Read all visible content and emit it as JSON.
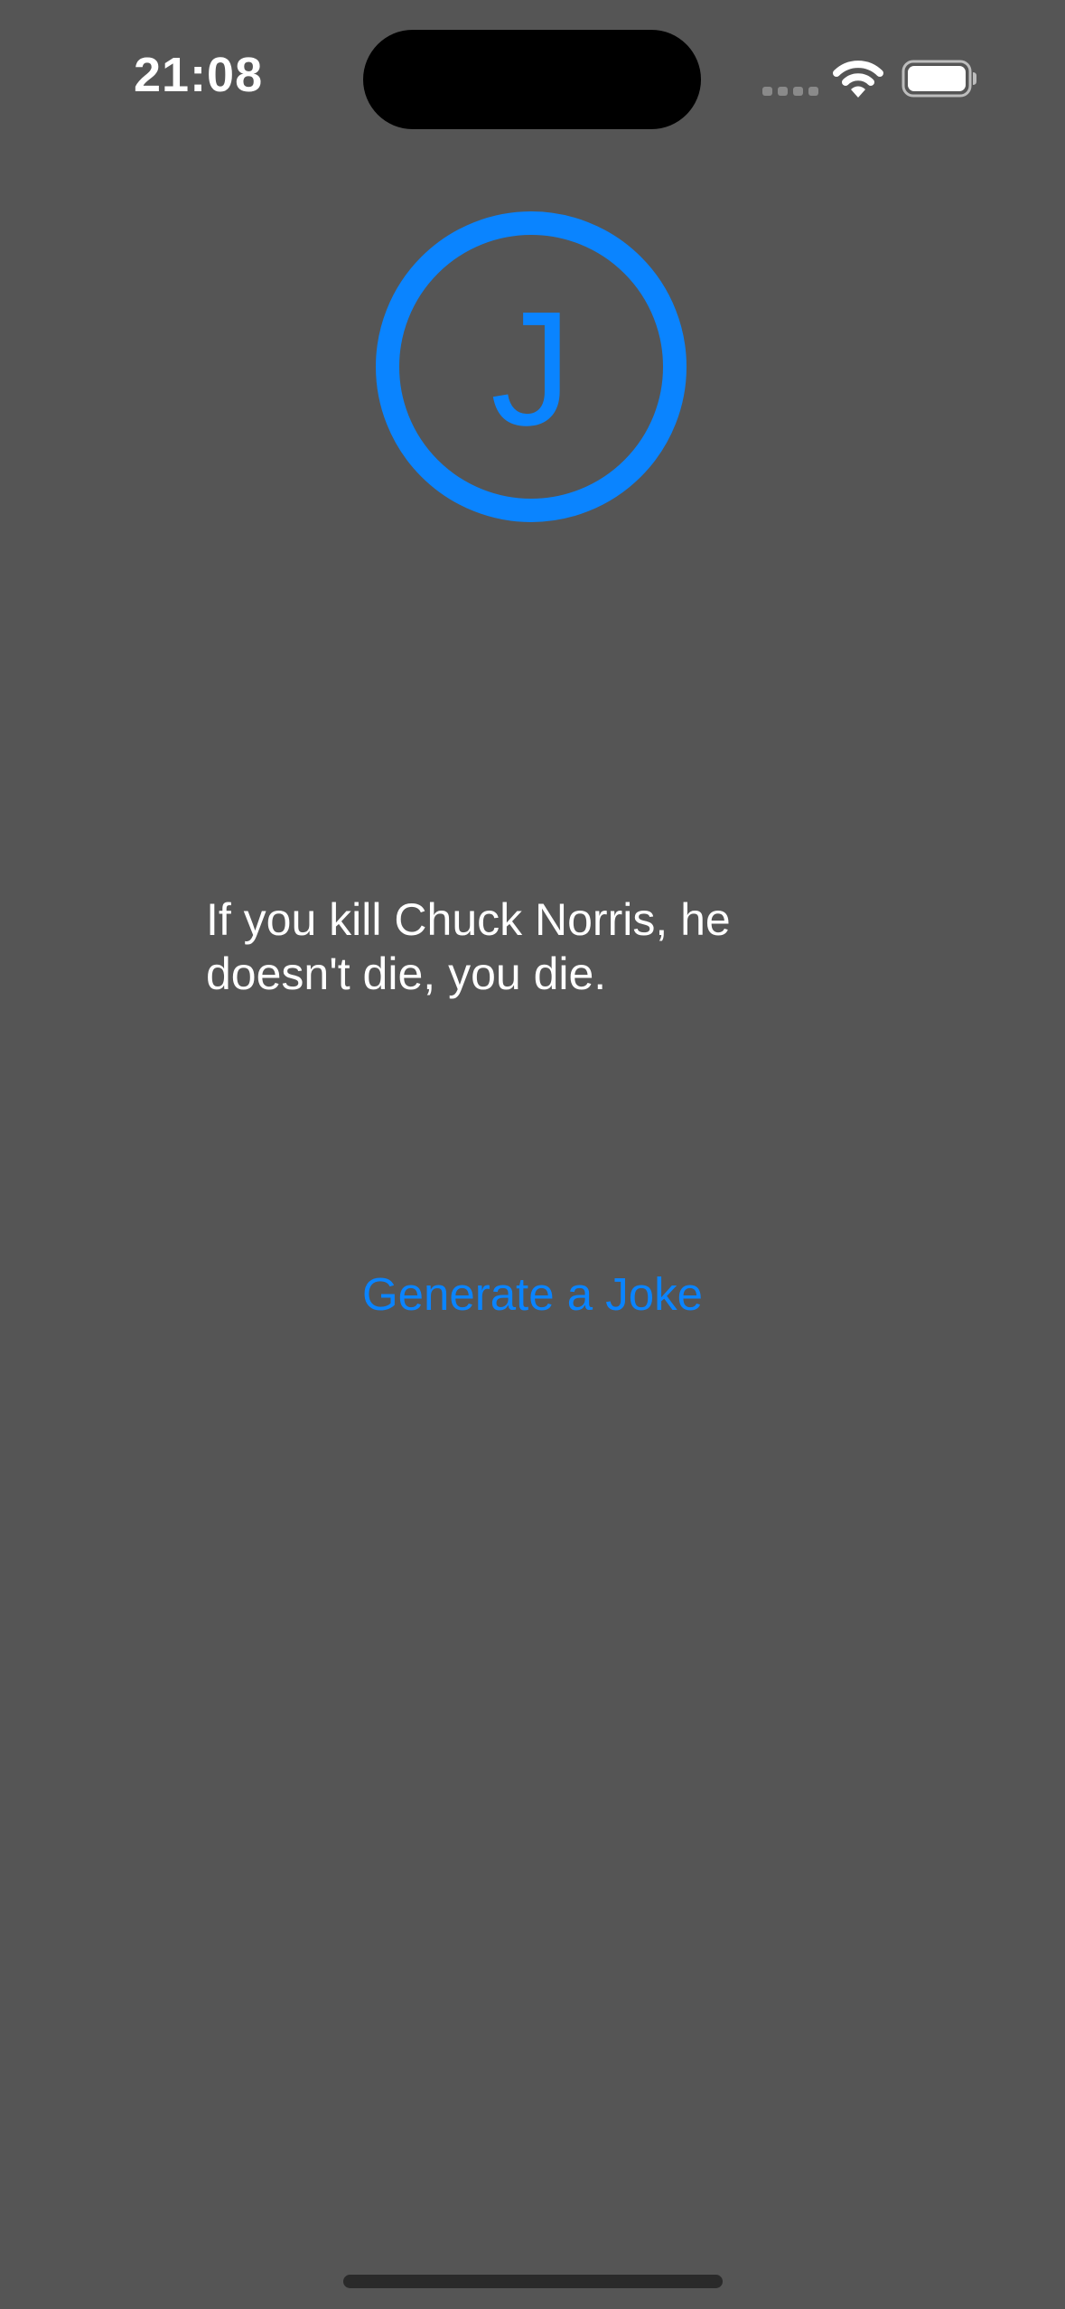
{
  "status_bar": {
    "time": "21:08"
  },
  "logo": {
    "letter": "J",
    "color": "#0A84FF"
  },
  "joke": {
    "text": "If you kill Chuck Norris, he doesn't die, you die."
  },
  "actions": {
    "generate_label": "Generate a Joke"
  },
  "colors": {
    "background": "#555555",
    "accent": "#0A84FF",
    "text": "#FFFFFF"
  }
}
